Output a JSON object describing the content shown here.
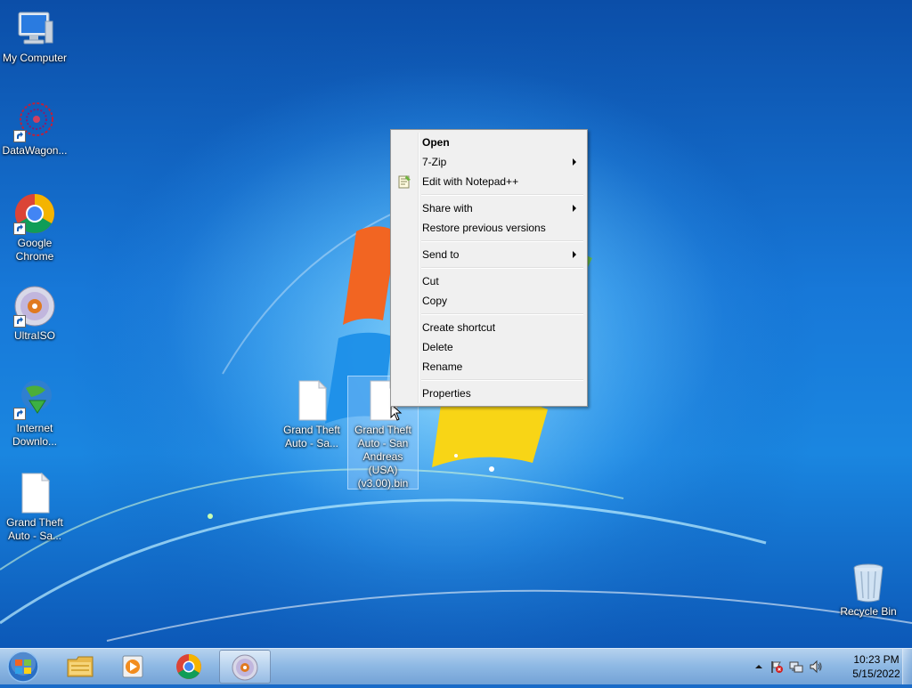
{
  "desktop_icons": [
    {
      "label": "My Computer",
      "icon": "computer-icon"
    },
    {
      "label": "DataWagon...",
      "icon": "datawagon-icon"
    },
    {
      "label": "Google Chrome",
      "icon": "chrome-icon"
    },
    {
      "label": "UltraISO",
      "icon": "ultraiso-disc-icon"
    },
    {
      "label": "Internet Downlo...",
      "icon": "internet-download-manager-icon"
    },
    {
      "label": "Grand Theft Auto - Sa...",
      "icon": "file-icon"
    },
    {
      "label": "Grand Theft Auto - Sa...",
      "icon": "file-icon"
    },
    {
      "label": "Grand Theft Auto - San Andreas (USA) (v3.00).bin",
      "icon": "file-icon"
    },
    {
      "label": "Recycle Bin",
      "icon": "recycle-bin-icon"
    }
  ],
  "context_menu": {
    "items": [
      {
        "label": "Open"
      },
      {
        "label": "7-Zip"
      },
      {
        "label": "Edit with Notepad++"
      },
      {
        "label": "Share with"
      },
      {
        "label": "Restore previous versions"
      },
      {
        "label": "Send to"
      },
      {
        "label": "Cut"
      },
      {
        "label": "Copy"
      },
      {
        "label": "Create shortcut"
      },
      {
        "label": "Delete"
      },
      {
        "label": "Rename"
      },
      {
        "label": "Properties"
      }
    ]
  },
  "taskbar": {
    "pinned": [
      "windows-explorer-icon",
      "media-player-icon",
      "chrome-icon",
      "ultraiso-disc-icon"
    ],
    "tray": {
      "time": "10:23 PM",
      "date": "5/15/2022"
    }
  },
  "colors": {
    "desktop_blue": "#1a6bc8",
    "menu_bg": "#f0f0f0",
    "menu_border": "#979797"
  }
}
